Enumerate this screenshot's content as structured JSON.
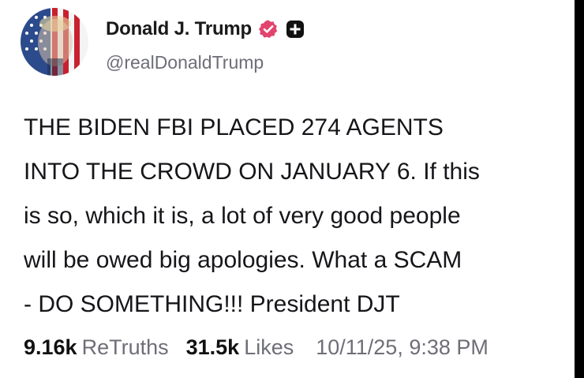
{
  "author": {
    "display_name": "Donald J. Trump",
    "handle": "@realDonaldTrump",
    "avatar_icon": "profile-photo-flag-overlay",
    "verified_icon": "verified-badge-icon",
    "verified_color": "#e3446e",
    "plus_icon": "plus-square-icon"
  },
  "post": {
    "lines": [
      "THE BIDEN FBI PLACED 274 AGENTS",
      "INTO THE CROWD ON JANUARY 6. If this",
      "is so, which it is, a lot of very good people",
      "will be owed big apologies. What a SCAM",
      "- DO SOMETHING!!! President DJT"
    ]
  },
  "stats": {
    "retruths_count": "9.16k",
    "retruths_label": "ReTruths",
    "likes_count": "31.5k",
    "likes_label": "Likes",
    "timestamp": "10/11/25, 9:38 PM"
  }
}
